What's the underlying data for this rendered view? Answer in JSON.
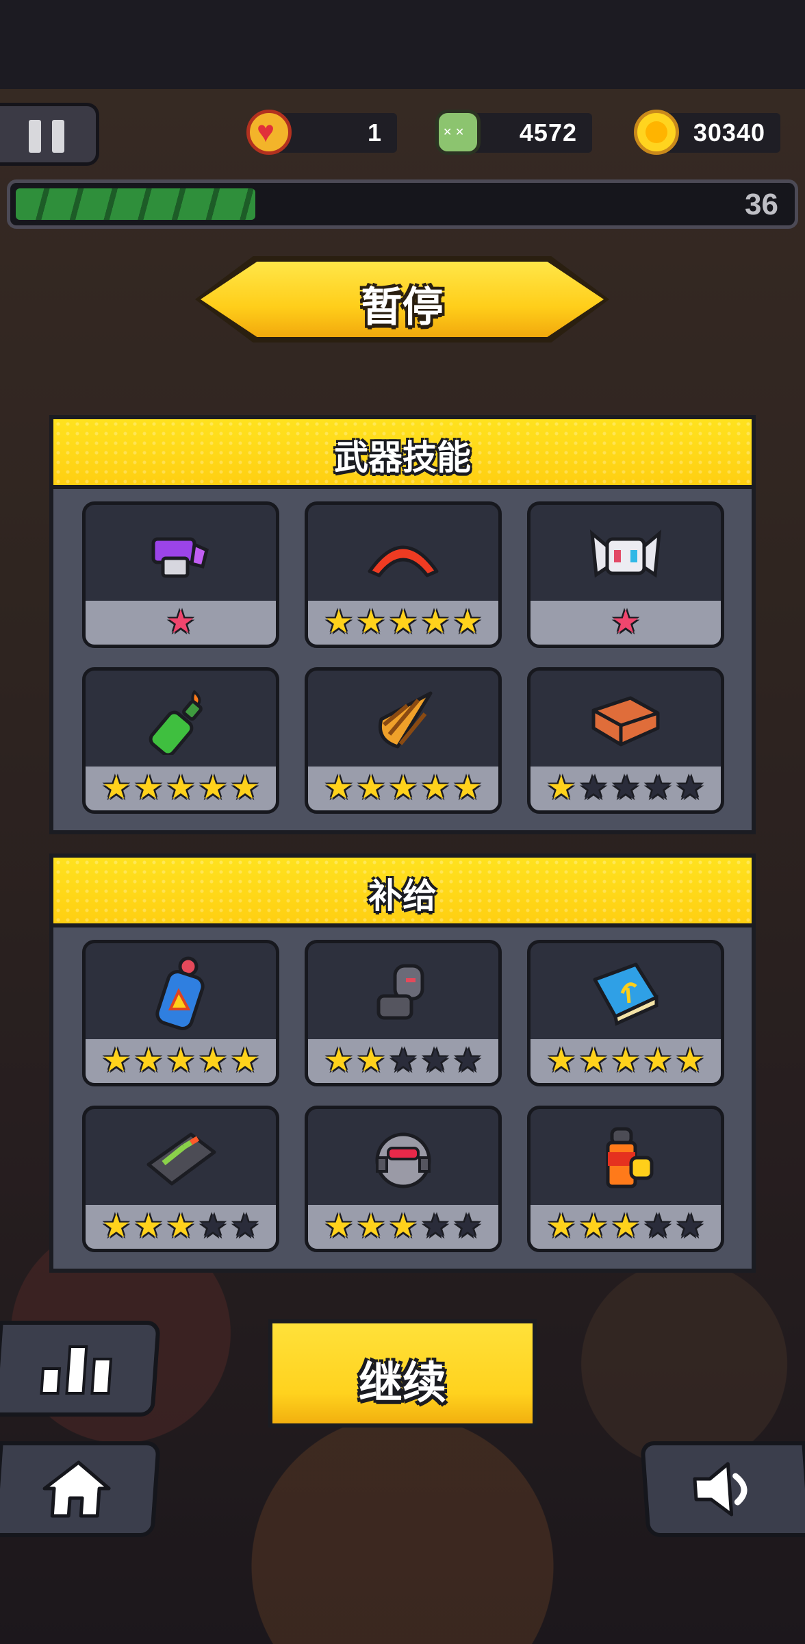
{
  "hud": {
    "lives": "1",
    "kills": "4572",
    "coins": "30340",
    "level": "36",
    "xp_progress": 0.31
  },
  "title": "暂停",
  "weapons": {
    "title": "武器技能",
    "items": [
      {
        "icon": "purple-gun-icon",
        "stars": 1,
        "max": 1,
        "style": "pink"
      },
      {
        "icon": "boomerang-icon",
        "stars": 5,
        "max": 5,
        "style": "gold"
      },
      {
        "icon": "drone-robot-icon",
        "stars": 1,
        "max": 1,
        "style": "pink"
      },
      {
        "icon": "molotov-bottle-icon",
        "stars": 5,
        "max": 5,
        "style": "gold"
      },
      {
        "icon": "drill-cone-icon",
        "stars": 5,
        "max": 5,
        "style": "gold"
      },
      {
        "icon": "brick-icon",
        "stars": 1,
        "max": 5,
        "style": "gold"
      }
    ]
  },
  "supplies": {
    "title": "补给",
    "items": [
      {
        "icon": "fuel-canister-icon",
        "stars": 5,
        "max": 5,
        "style": "gold"
      },
      {
        "icon": "armor-gauntlet-icon",
        "stars": 2,
        "max": 5,
        "style": "gold"
      },
      {
        "icon": "book-icon",
        "stars": 5,
        "max": 5,
        "style": "gold"
      },
      {
        "icon": "battery-pack-icon",
        "stars": 3,
        "max": 5,
        "style": "gold"
      },
      {
        "icon": "magnet-orb-icon",
        "stars": 3,
        "max": 5,
        "style": "gold"
      },
      {
        "icon": "ammo-canister-icon",
        "stars": 3,
        "max": 5,
        "style": "gold"
      }
    ]
  },
  "buttons": {
    "continue": "继续",
    "stats_icon": "bar-chart-icon",
    "home_icon": "home-icon",
    "sound_icon": "speaker-icon"
  },
  "colors": {
    "accent_yellow": "#ffd21c",
    "panel": "#4d5160",
    "card": "#2d303d",
    "star_pink": "#f0466e",
    "xp_green": "#2f8f3b"
  }
}
